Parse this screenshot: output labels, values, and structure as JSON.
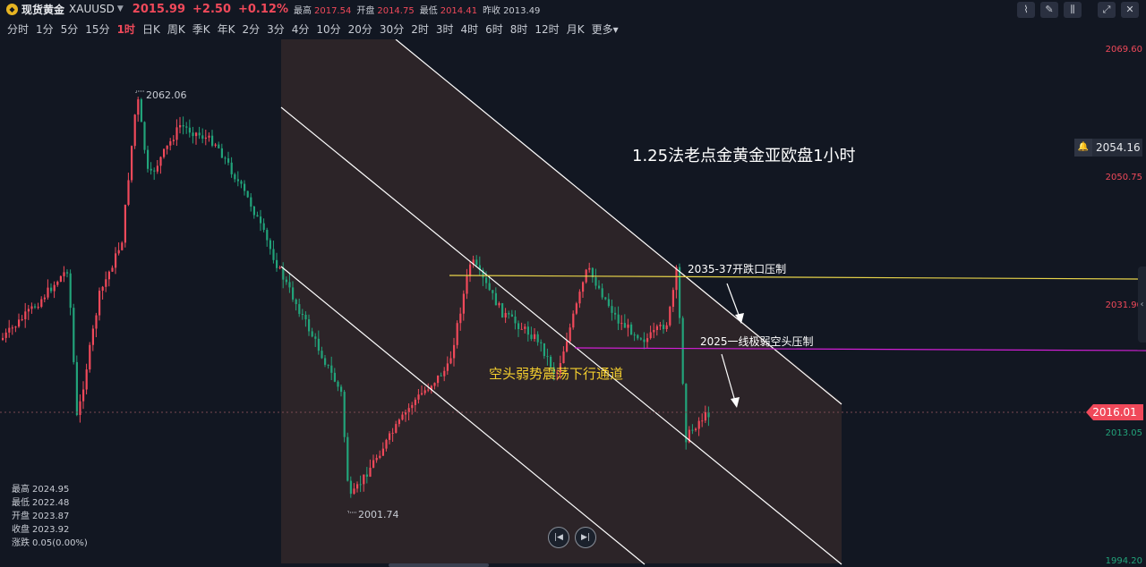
{
  "header": {
    "symbol_name": "现货黄金",
    "symbol_code": "XAUUSD",
    "price": "2015.99",
    "change": "+2.50",
    "change_pct": "+0.12%",
    "stats": [
      {
        "label": "最高",
        "value": "2017.54",
        "color": "red"
      },
      {
        "label": "开盘",
        "value": "2014.75",
        "color": "red"
      },
      {
        "label": "最低",
        "value": "2014.41",
        "color": "red"
      },
      {
        "label": "昨收",
        "value": "2013.49",
        "color": "grey"
      }
    ]
  },
  "toolbar_icons": [
    "indicator-icon",
    "draw-icon",
    "candle-type-icon",
    "fullscreen-icon",
    "close-icon"
  ],
  "periods": {
    "items": [
      "分时",
      "1分",
      "5分",
      "15分",
      "1时",
      "日K",
      "周K",
      "季K",
      "年K",
      "2分",
      "3分",
      "4分",
      "10分",
      "20分",
      "30分",
      "2时",
      "3时",
      "4时",
      "6时",
      "8时",
      "12时",
      "月K",
      "更多▾"
    ],
    "active": "1时"
  },
  "price_axis": [
    "2069.60",
    "2050.75",
    "2031.90",
    "2013.05",
    "1994.20"
  ],
  "current_price": "2016.01",
  "alert_price": "2054.16",
  "markers": {
    "high": "2062.06",
    "low": "2001.74"
  },
  "annotations": {
    "title": "1.25法老点金黄金亚欧盘1小时",
    "resistance1": "2035-37开跌口压制",
    "resistance2": "2025一线极弱空头压制",
    "channel": "空头弱势震荡下行通道"
  },
  "ohlc_panel": [
    {
      "label": "最高",
      "value": "2024.95"
    },
    {
      "label": "最低",
      "value": "2022.48"
    },
    {
      "label": "开盘",
      "value": "2023.87"
    },
    {
      "label": "收盘",
      "value": "2023.92"
    },
    {
      "label": "涨跌",
      "value": "0.05(0.00%)"
    }
  ],
  "colors": {
    "up": "#f0495a",
    "down": "#22a37a",
    "background": "#121722",
    "yellow_line": "#e8d44a",
    "magenta_line": "#d21fd6",
    "channel_fill": "#2c2428"
  },
  "chart_data": {
    "type": "candlestick",
    "ylim": [
      1994.2,
      2069.6
    ],
    "key_prices": {
      "high": 2062.06,
      "low": 2001.74,
      "last": 2016.01,
      "alert": 2054.16,
      "yellow_line": 2035.5,
      "magenta_line": 2025
    }
  }
}
